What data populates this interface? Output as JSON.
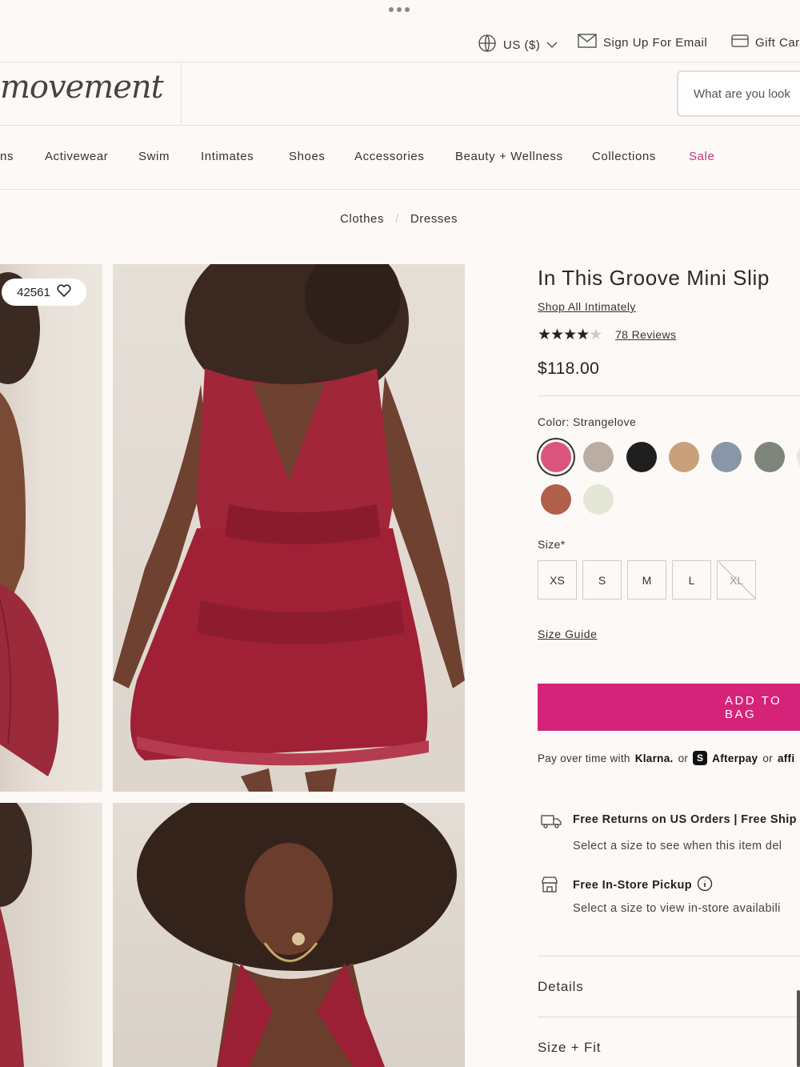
{
  "utility": {
    "locale": "US ($)",
    "email": "Sign Up For Email",
    "gift": "Gift Car"
  },
  "header": {
    "logo": "movement",
    "search_placeholder": "What are you look"
  },
  "nav": [
    "ns",
    "Activewear",
    "Swim",
    "Intimates",
    "Shoes",
    "Accessories",
    "Beauty + Wellness",
    "Collections",
    "Sale"
  ],
  "breadcrumb": [
    "Clothes",
    "Dresses"
  ],
  "gallery": {
    "wishlist_count": "42561"
  },
  "product": {
    "title": "In This Groove Mini Slip",
    "shop_all": "Shop All Intimately",
    "rating": 4,
    "rating_max": 5,
    "reviews": "78 Reviews",
    "price": "$118.00",
    "color_label": "Color: Strangelove",
    "colors": [
      "#d9557d",
      "#b9ada4",
      "#1f1f1f",
      "#c8a07a",
      "#8896a8",
      "#7e857a",
      "#e8e6e2",
      "#b15f4a",
      "#e4e6d6"
    ],
    "size_label": "Size*",
    "sizes": [
      "XS",
      "S",
      "M",
      "L",
      "XL"
    ],
    "size_guide": "Size Guide",
    "add_to_bag": "ADD TO BAG",
    "pay_prefix": "Pay over time with",
    "klarna": "Klarna.",
    "or": "or",
    "afterpay": "Afterpay",
    "affirm": "affi",
    "returns_head": "Free Returns on US Orders | Free Ship",
    "returns_sub": "Select a size to see when this item del",
    "pickup_head": "Free In-Store Pickup",
    "pickup_sub": "Select a size to view in-store availabili",
    "details": "Details",
    "size_fit": "Size + Fit"
  }
}
